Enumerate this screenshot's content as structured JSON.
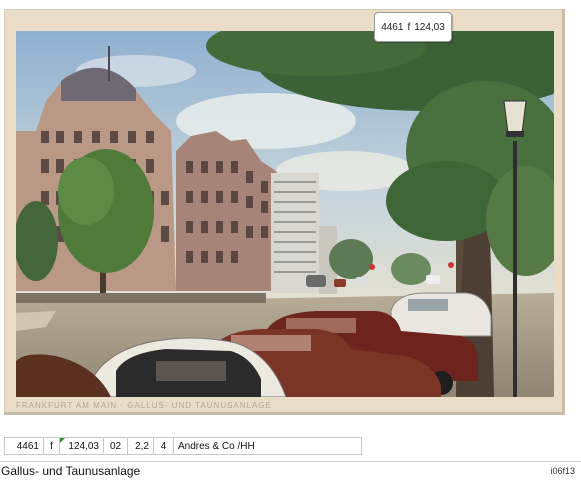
{
  "postcard": {
    "caption": "FRANKFURT AM MAIN · GALLUS- UND TAUNUSANLAGE",
    "price_label": {
      "number": "4461",
      "type": "f",
      "price": "124,03"
    }
  },
  "info_row": {
    "number": "4461",
    "type": "f",
    "price": "124,03",
    "col_a": "02",
    "col_b": "2,2",
    "col_c": "4",
    "dealer": "Andres & Co /HH"
  },
  "title": "Gallus- und Taunusanlage",
  "code": "i06f13",
  "colors": {
    "card_background": "#e9ddc8",
    "sky": "#9cb8d0",
    "foliage": "#3f6b3a",
    "car_red": "#7a2a1f",
    "flag_green": "#2e8b2e"
  }
}
